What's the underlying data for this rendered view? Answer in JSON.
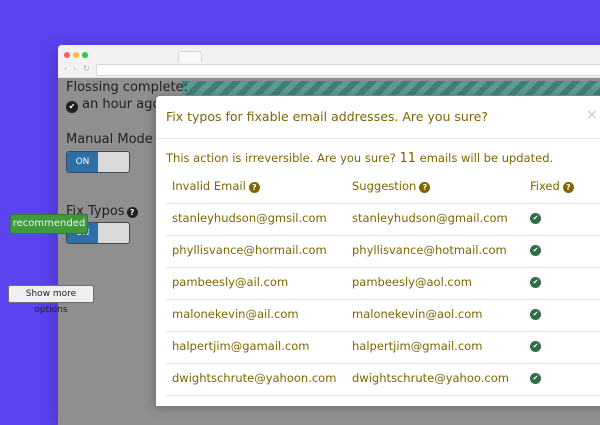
{
  "browser": {
    "nav_back": "‹",
    "nav_forward": "›",
    "nav_reload": "↻"
  },
  "background_page": {
    "flossing_label": "Flossing complete:",
    "flossing_time": "an hour ago",
    "manual_mode_label": "Manual Mode",
    "manual_mode_state": "ON",
    "fix_typos_label": "Fix Typos",
    "fix_typos_state": "ON",
    "recommended_badge": "recommended",
    "show_more_button": "Show more options"
  },
  "modal": {
    "title": "Fix typos for fixable email addresses. Are you sure?",
    "close": "×",
    "warning_prefix": "This action is irreversible. Are you sure?",
    "count": "11",
    "warning_suffix": "emails will be updated.",
    "columns": [
      "Invalid Email",
      "Suggestion",
      "Fixed"
    ],
    "rows": [
      {
        "invalid": "stanleyhudson@gmsil.com",
        "suggestion": "stanleyhudson@gmail.com"
      },
      {
        "invalid": "phyllisvance@hormail.com",
        "suggestion": "phyllisvance@hotmail.com"
      },
      {
        "invalid": "pambeesly@ail.com",
        "suggestion": "pambeesly@aol.com"
      },
      {
        "invalid": "malonekevin@ail.com",
        "suggestion": "malonekevin@aol.com"
      },
      {
        "invalid": "halpertjim@gamail.com",
        "suggestion": "halpertjim@gmail.com"
      },
      {
        "invalid": "dwightschrute@yahoon.com",
        "suggestion": "dwightschrute@yahoo.com"
      }
    ]
  },
  "colors": {
    "backdrop": "#5b43f0",
    "modal_text": "#7c6700",
    "fixed_check": "#2f6e45",
    "toggle_on": "#2f6fa8",
    "badge_green": "#3f9a3f"
  },
  "icons": {
    "check": "✔",
    "question": "?"
  }
}
